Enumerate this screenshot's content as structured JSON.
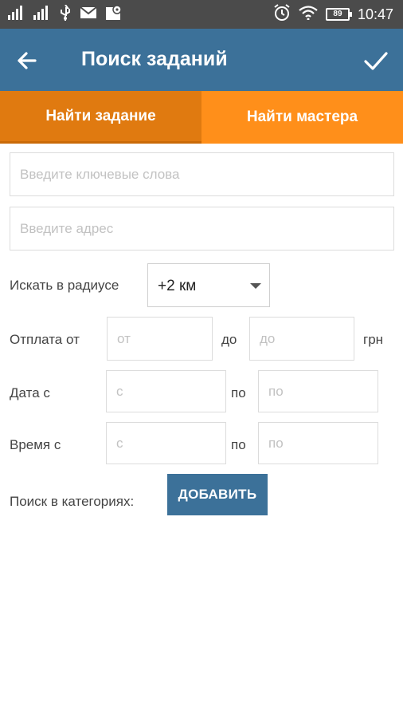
{
  "status_bar": {
    "icons": [
      "signal-icon",
      "signal-icon",
      "usb-icon",
      "mail-icon",
      "map-icon",
      "alarm-icon",
      "wifi-icon",
      "battery-icon"
    ],
    "battery": "89",
    "time": "10:47"
  },
  "app_bar": {
    "title": "Поиск заданий",
    "color": "#3c7199"
  },
  "tabs": [
    {
      "label": "Найти задание",
      "color": "#e07a10",
      "selected": true
    },
    {
      "label": "Найти мастера",
      "color": "#ff8f1a",
      "selected": false
    }
  ],
  "form": {
    "keywords_placeholder": "Введите ключевые слова",
    "address_placeholder": "Введите адрес",
    "radius_label": "Искать в радиусе",
    "radius_value": "+2 км",
    "payment_label": "Отплата от",
    "payment_from_placeholder": "от",
    "payment_to_label": "до",
    "payment_to_placeholder": "до",
    "currency": "грн",
    "date_label": "Дата с",
    "date_from_placeholder": "с",
    "date_to_label": "по",
    "date_to_placeholder": "по",
    "time_label": "Время с",
    "time_from_placeholder": "с",
    "time_to_label": "по",
    "time_to_placeholder": "по",
    "category_label": "Поиск в категориях:",
    "add_button": "ДОБАВИТЬ"
  }
}
